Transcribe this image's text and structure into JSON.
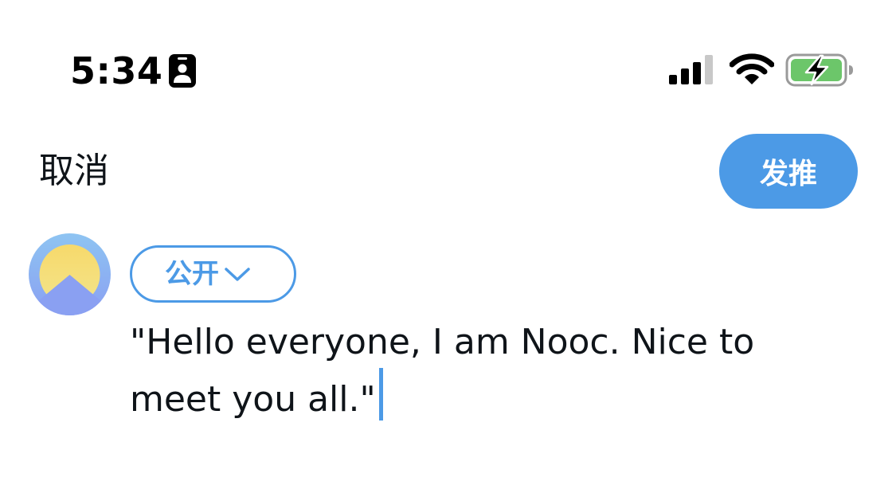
{
  "status_bar": {
    "time": "5:34",
    "icons": [
      "id-card-icon",
      "cellular-signal-icon",
      "wifi-icon",
      "battery-charging-icon"
    ]
  },
  "header": {
    "cancel_label": "取消",
    "post_label": "发推"
  },
  "composer": {
    "audience_label": "公开",
    "audience_icon": "chevron-down-icon",
    "text": "\"Hello everyone, I am Nooc. Nice to meet you all.\""
  },
  "colors": {
    "accent": "#4c9ae6",
    "text": "#0f1419",
    "battery_fill": "#6cc66a"
  }
}
